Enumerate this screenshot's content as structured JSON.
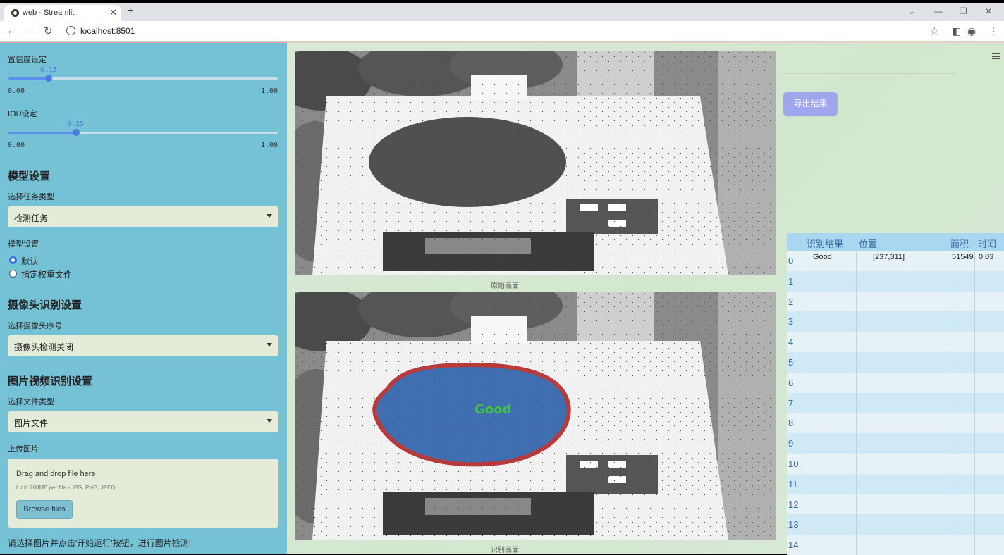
{
  "browser": {
    "tab_title": "web · Streamlit",
    "url": "localhost:8501"
  },
  "sidebar": {
    "conf_label": "置信度设定",
    "conf_value": "0.15",
    "conf_level": 0.15,
    "conf_min": "0.00",
    "conf_max": "1.00",
    "iou_label": "IOU设定",
    "iou_value": "0.25",
    "iou_level": 0.25,
    "iou_min": "0.00",
    "iou_max": "1.00",
    "model_header": "模型设置",
    "task_label": "选择任务类型",
    "task_value": "检测任务",
    "model_label": "模型设置",
    "model_options": [
      "默认",
      "指定权重文件"
    ],
    "camera_header": "摄像头识别设置",
    "camera_label": "选择摄像头序号",
    "camera_value": "摄像头检测关闭",
    "media_header": "图片视频识别设置",
    "filetype_label": "选择文件类型",
    "filetype_value": "图片文件",
    "upload_label": "上传图片",
    "upload_drag": "Drag and drop file here",
    "upload_limit": "Limit 200MB per file • JPG, PNG, JPEG",
    "browse_label": "Browse files",
    "hint": "请选择图片并点击'开始运行'按钮，进行图片检测!"
  },
  "main": {
    "original_caption": "原始画面",
    "detected_caption": "识别画面",
    "detection_label": "Good",
    "export_label": "导出结果"
  },
  "table": {
    "headers": [
      "识别结果",
      "位置",
      "面积",
      "时间"
    ],
    "rows": [
      {
        "idx": "0",
        "result": "Good",
        "pos": "[237,311]",
        "area": "51549",
        "time": "0.03"
      },
      {
        "idx": "1"
      },
      {
        "idx": "2"
      },
      {
        "idx": "3"
      },
      {
        "idx": "4"
      },
      {
        "idx": "5"
      },
      {
        "idx": "6"
      },
      {
        "idx": "7"
      },
      {
        "idx": "8"
      },
      {
        "idx": "9"
      },
      {
        "idx": "10"
      },
      {
        "idx": "11"
      },
      {
        "idx": "12"
      },
      {
        "idx": "13"
      },
      {
        "idx": "14"
      }
    ]
  },
  "colors": {
    "sidebar_bg": "#75c1d6",
    "accent": "#4a7de0",
    "export_button": "#9fa6ee",
    "detection_fill": "#3f6fb0",
    "detection_outline": "#b83a3a",
    "detection_text": "#3fc23f"
  }
}
